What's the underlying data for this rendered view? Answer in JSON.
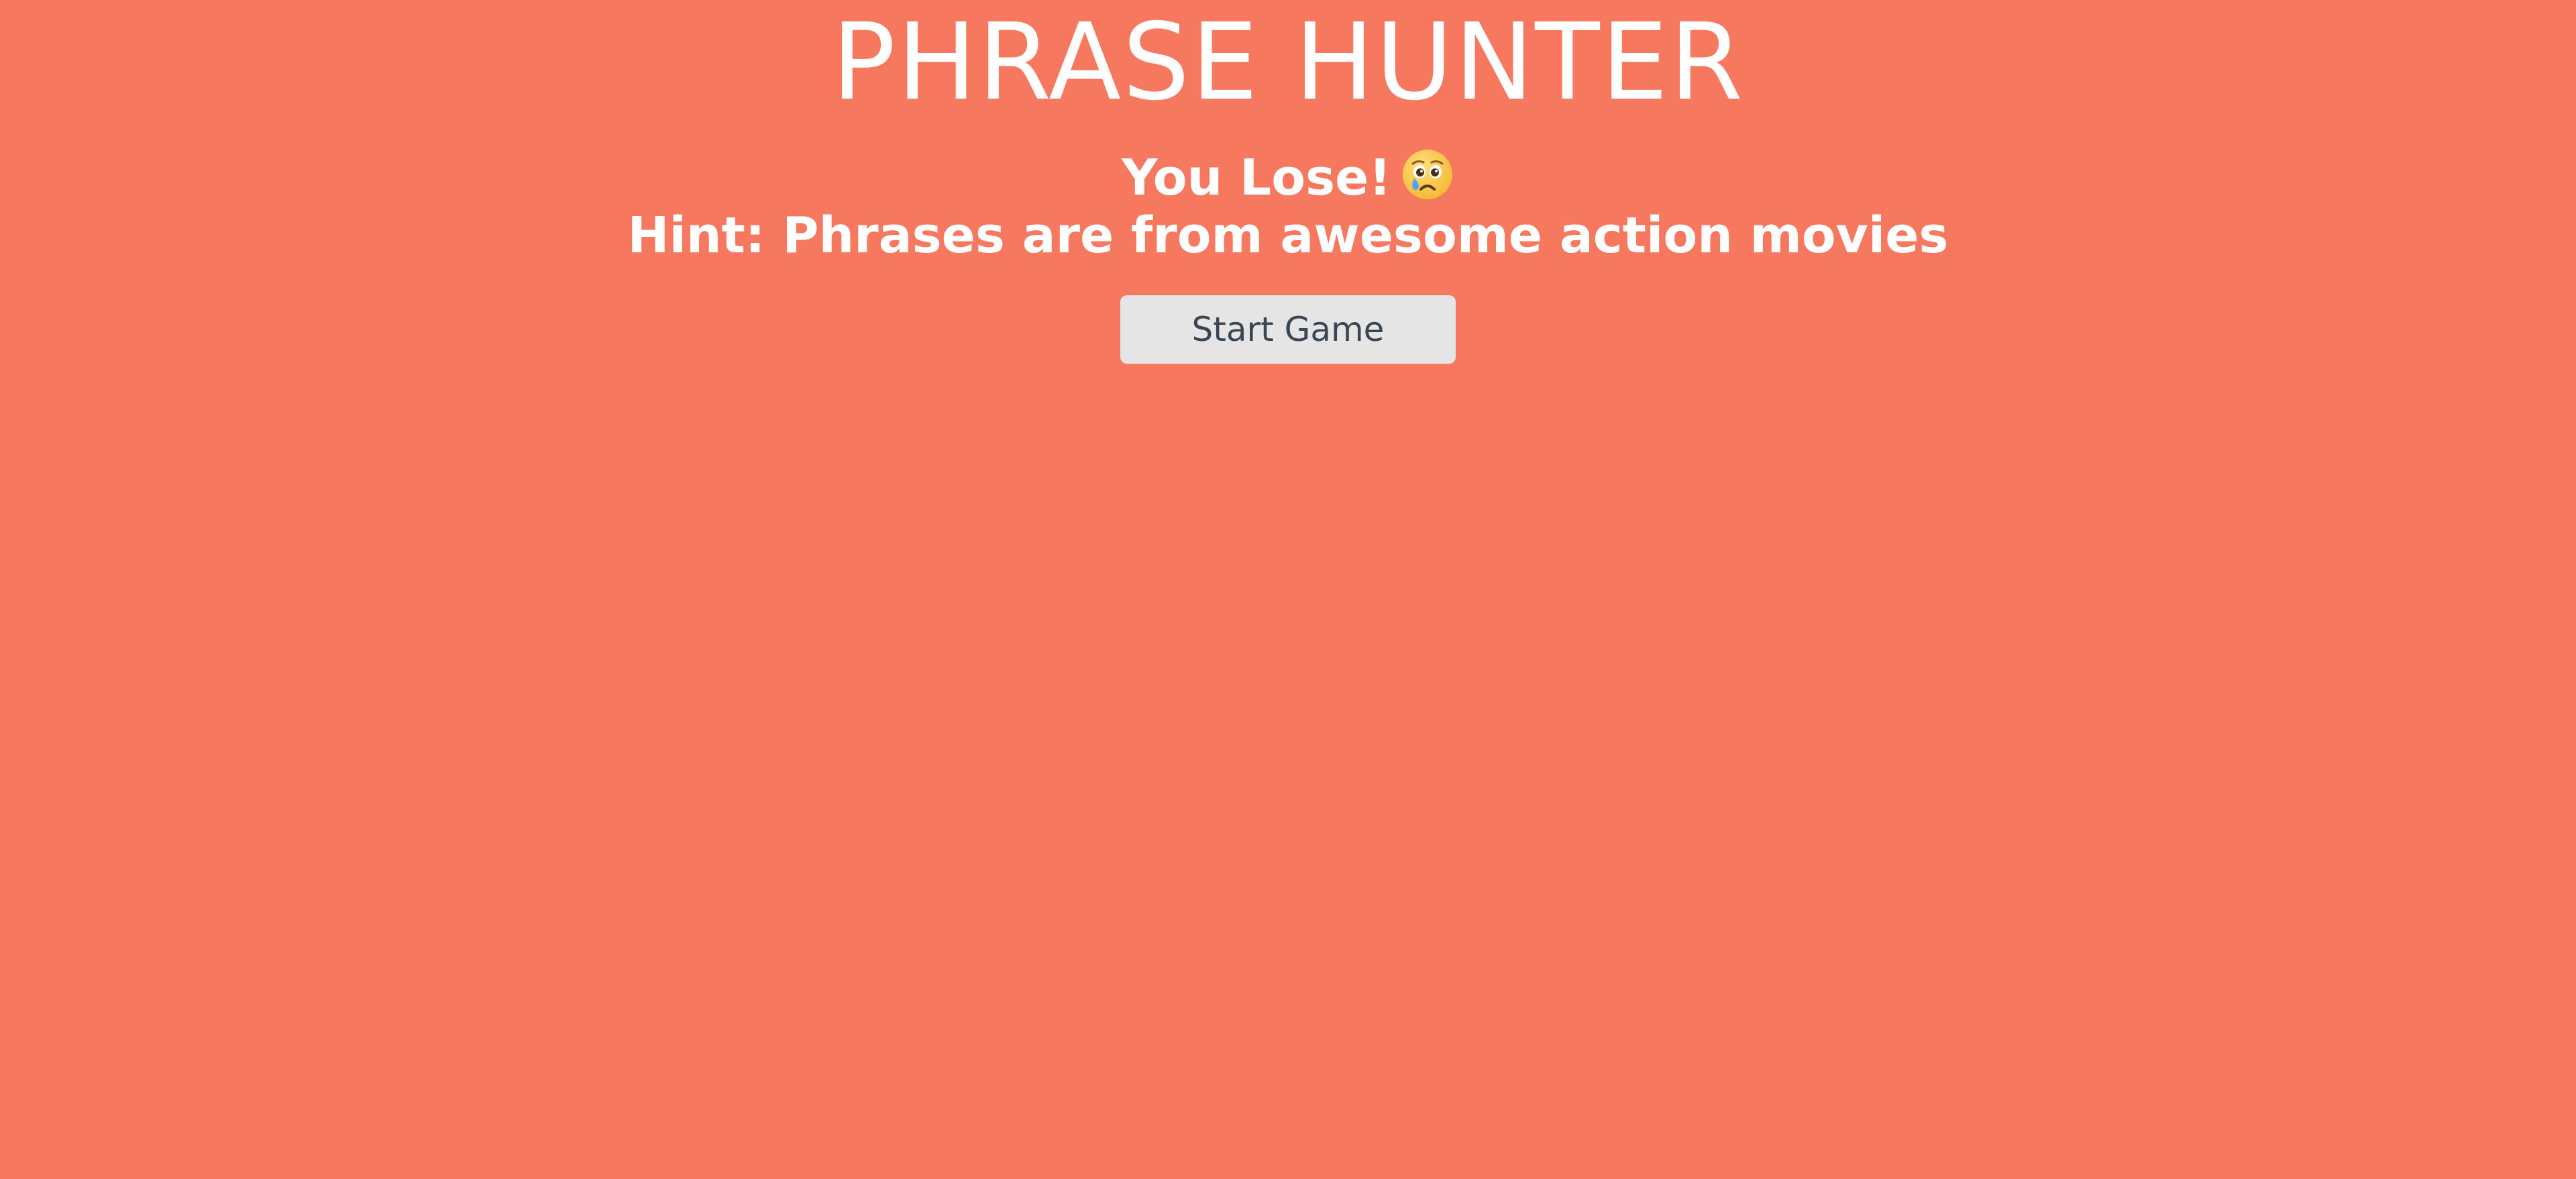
{
  "title": "PHRASE HUNTER",
  "message": {
    "result": "You Lose!",
    "emoji_icon": "sad-face-with-tear-icon",
    "hint": "Hint: Phrases are from awesome action movies"
  },
  "start_button": {
    "label": "Start Game"
  },
  "colors": {
    "background": "#F5785F",
    "text": "#FFFFFF",
    "button_bg": "#E5E5E5",
    "button_text": "#3A4652"
  }
}
